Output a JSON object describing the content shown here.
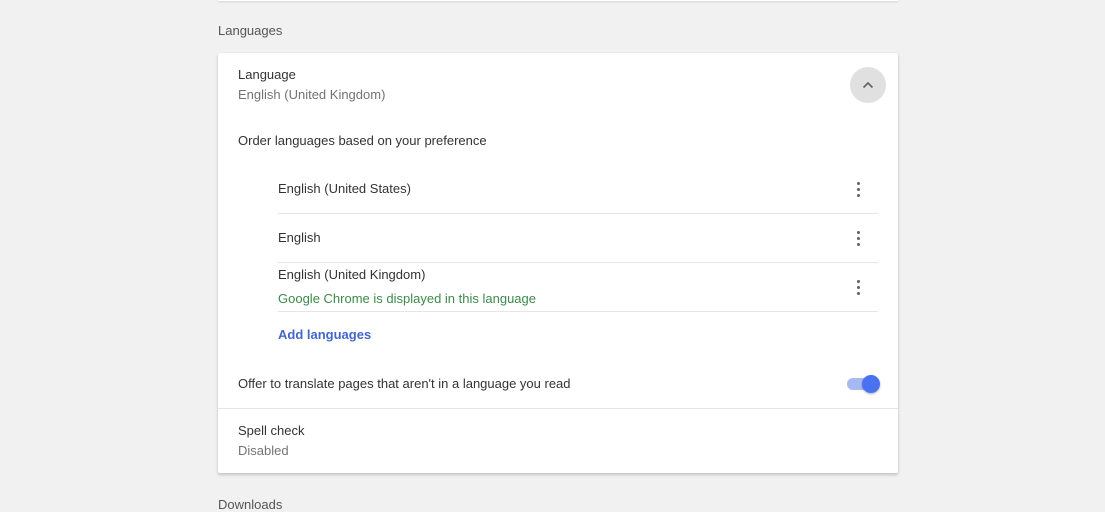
{
  "sections": {
    "languages_heading": "Languages",
    "downloads_heading": "Downloads"
  },
  "language": {
    "title": "Language",
    "current": "English (United Kingdom)",
    "expanded": true,
    "order_hint": "Order languages based on your preference",
    "items": [
      {
        "name": "English (United States)",
        "note": ""
      },
      {
        "name": "English",
        "note": ""
      },
      {
        "name": "English (United Kingdom)",
        "note": "Google Chrome is displayed in this language"
      }
    ],
    "add_label": "Add languages",
    "more_icon": "more-vert-icon"
  },
  "translate": {
    "label": "Offer to translate pages that aren't in a language you read",
    "enabled": true
  },
  "spell_check": {
    "title": "Spell check",
    "status": "Disabled"
  },
  "colors": {
    "accent": "#4a72f0",
    "note_green": "#3d8a4a",
    "link_blue": "#4466cc"
  }
}
